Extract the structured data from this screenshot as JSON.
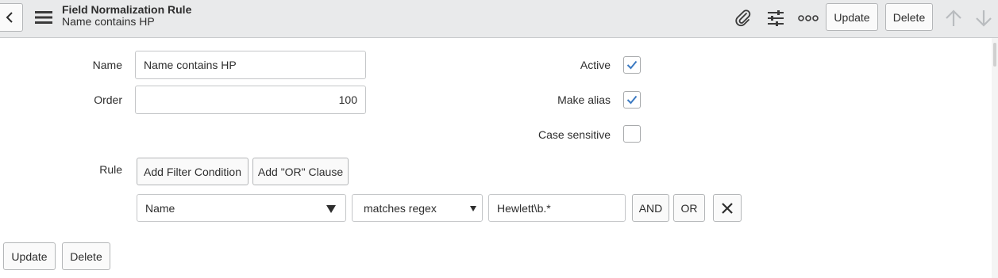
{
  "header": {
    "title": "Field Normalization Rule",
    "subtitle": "Name contains HP",
    "update_label": "Update",
    "delete_label": "Delete"
  },
  "icons": {
    "back": "chevron-left-icon",
    "menu": "hamburger-menu-icon",
    "attachment": "paperclip-icon",
    "personalize": "sliders-icon",
    "more": "more-options-icon",
    "previous": "arrow-up-icon",
    "next": "arrow-down-icon",
    "remove_condition": "close-icon"
  },
  "form": {
    "name_label": "Name",
    "name_value": "Name contains HP",
    "order_label": "Order",
    "order_value": "100",
    "active_label": "Active",
    "active_checked": true,
    "make_alias_label": "Make alias",
    "make_alias_checked": true,
    "case_sensitive_label": "Case sensitive",
    "case_sensitive_checked": false,
    "rule_label": "Rule"
  },
  "rule": {
    "add_filter_label": "Add Filter Condition",
    "add_or_label": "Add \"OR\" Clause",
    "field_value": "Name",
    "operator_value": "matches regex",
    "condition_value": "Hewlett\\b.*",
    "and_label": "AND",
    "or_label": "OR"
  },
  "footer": {
    "update_label": "Update",
    "delete_label": "Delete"
  },
  "colors": {
    "header_bg": "#e9eaeb",
    "check_blue": "#3c7ac2",
    "disabled_arrow": "#b9bcbf"
  }
}
